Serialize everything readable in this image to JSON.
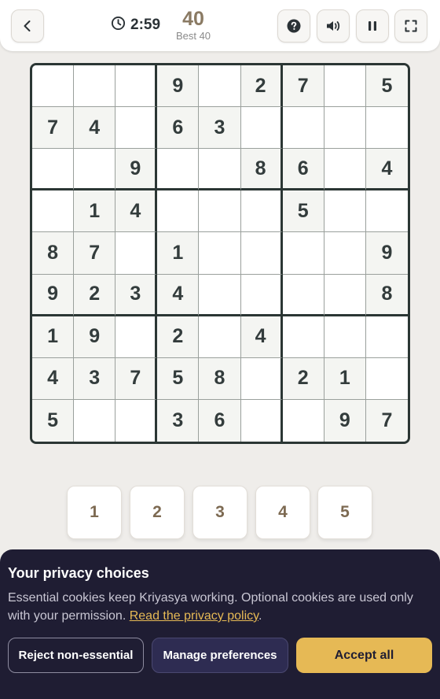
{
  "header": {
    "back_icon": "chevron-left-icon",
    "timer": "2:59",
    "score": "40",
    "best": "Best 40",
    "help_icon": "help-icon",
    "sound_icon": "speaker-icon",
    "pause_icon": "pause-icon",
    "fullscreen_icon": "fullscreen-icon"
  },
  "board": {
    "rows": [
      [
        "",
        "",
        "",
        "9",
        "",
        "2",
        "7",
        "",
        "5"
      ],
      [
        "7",
        "4",
        "",
        "6",
        "3",
        "",
        "",
        "",
        ""
      ],
      [
        "",
        "",
        "9",
        "",
        "",
        "8",
        "6",
        "",
        "4"
      ],
      [
        "",
        "1",
        "4",
        "",
        "",
        "",
        "5",
        "",
        ""
      ],
      [
        "8",
        "7",
        "",
        "1",
        "",
        "",
        "",
        "",
        "9"
      ],
      [
        "9",
        "2",
        "3",
        "4",
        "",
        "",
        "",
        "",
        "8"
      ],
      [
        "1",
        "9",
        "",
        "2",
        "",
        "4",
        "",
        "",
        ""
      ],
      [
        "4",
        "3",
        "7",
        "5",
        "8",
        "",
        "2",
        "1",
        ""
      ],
      [
        "5",
        "",
        "",
        "3",
        "6",
        "",
        "",
        "9",
        "7"
      ]
    ]
  },
  "number_pad": [
    "1",
    "2",
    "3",
    "4",
    "5"
  ],
  "privacy": {
    "title": "Your privacy choices",
    "text_1": "Essential cookies keep Kriyasya working. Optional cookies are used only with your permission. ",
    "link": "Read the privacy policy",
    "text_2": ".",
    "reject_label": "Reject non-essential",
    "manage_label": "Manage preferences",
    "accept_label": "Accept all"
  },
  "colors": {
    "accent": "#8a7a63",
    "banner_bg": "#1f1d33",
    "accept_bg": "#e6b955"
  }
}
